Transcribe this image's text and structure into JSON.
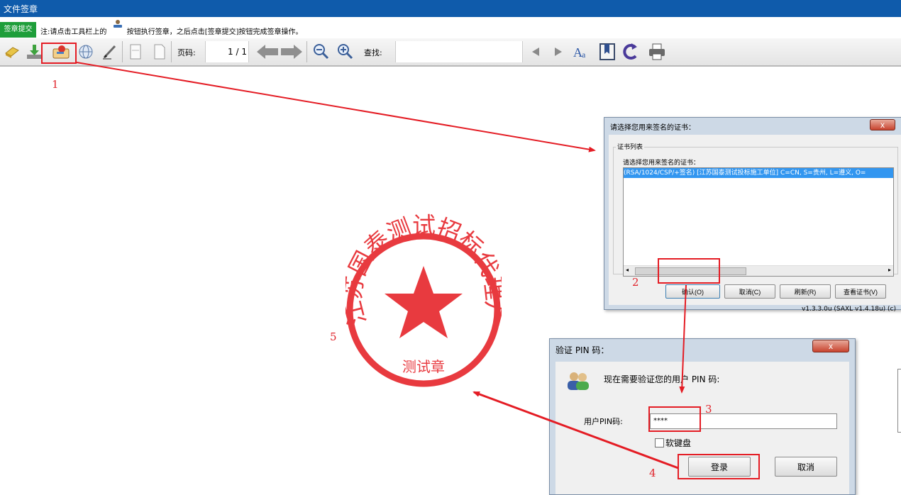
{
  "window": {
    "title": "文件签章"
  },
  "notice": {
    "submit_label": "签章提交",
    "text_before": "注:请点击工具栏上的",
    "text_after": "按钮执行签章，之后点击[签章提交]按钮完成签章操作。",
    "icon": "stamp-icon"
  },
  "toolbar": {
    "icons": [
      "eraser-icon",
      "download-icon",
      "sign-stamp-icon",
      "globe-icon",
      "pen-icon",
      "page-icon",
      "blank-page-icon",
      "prev-page-arrow-icon",
      "next-page-arrow-icon",
      "zoom-out-icon",
      "zoom-in-icon",
      "triangle-left-icon",
      "triangle-right-icon",
      "font-icon",
      "bookmark-icon",
      "rotate-icon",
      "print-icon"
    ],
    "page_label": "页码:",
    "page_value": "1 / 1",
    "search_label": "查找:",
    "search_value": ""
  },
  "stamp": {
    "text": "江苏国泰测试招标代理厂",
    "bottom_text": "测试章",
    "color": "#e83a3f"
  },
  "cert_dialog": {
    "title": "请选择您用来签名的证书：",
    "group_title": "证书列表",
    "prompt": "请选择您用来签名的证书：",
    "cert_row": "(RSA/1024/CSP/+签名) [江苏国泰测试投标施工单位] C=CN, S=贵州, L=遵义, O=",
    "ok_label": "确认(O)",
    "cancel_label": "取消(C)",
    "refresh_label": "刷新(R)",
    "view_label": "查看证书(V)",
    "version": "v1.3.3.0u (SAXL v1.4.18u) (c)",
    "close_label": "x"
  },
  "pin_dialog": {
    "title": "验证 PIN 码：",
    "message": "现在需要验证您的用户 PIN 码:",
    "pin_label": "用户PIN码:",
    "pin_value": "****",
    "soft_keyboard_label": "软键盘",
    "login_label": "登录",
    "cancel_label": "取消",
    "close_label": "x"
  },
  "annotations": {
    "step1": "1",
    "step2": "2",
    "step3": "3",
    "step4": "4",
    "step5": "5",
    "color": "#e41c24"
  }
}
